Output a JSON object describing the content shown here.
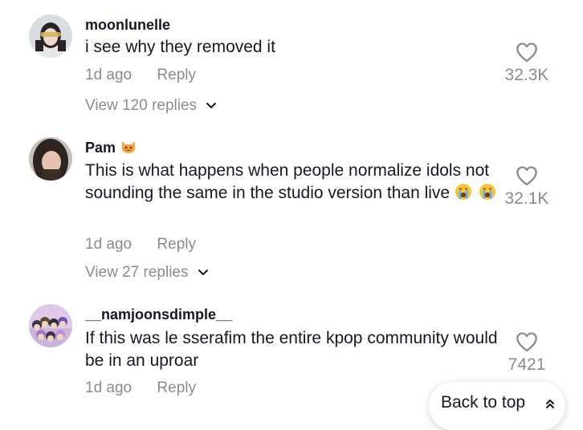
{
  "comments": [
    {
      "username": "moonlunelle",
      "text": "i see why they removed it",
      "time": "1d ago",
      "reply_label": "Reply",
      "likes": "32.3K",
      "view_replies": "View 120 replies"
    },
    {
      "username": "Pam",
      "text": "This is what happens when people normalize idols not sounding the same in the studio version than live",
      "time": "1d ago",
      "reply_label": "Reply",
      "likes": "32.1K",
      "view_replies": "View 27 replies"
    },
    {
      "username": "__namjoonsdimple__",
      "text": "If this was le sserafim the entire kpop community would be in an uproar",
      "time": "1d ago",
      "reply_label": "Reply",
      "likes": "7421"
    }
  ],
  "back_to_top": "Back to top",
  "colors": {
    "text": "#161823",
    "secondary": "#8a8b91",
    "background": "#ffffff"
  },
  "icons": [
    "heart-icon",
    "chevron-down-icon",
    "double-chevron-up-icon",
    "cat-emoji",
    "crying-face-emoji"
  ]
}
